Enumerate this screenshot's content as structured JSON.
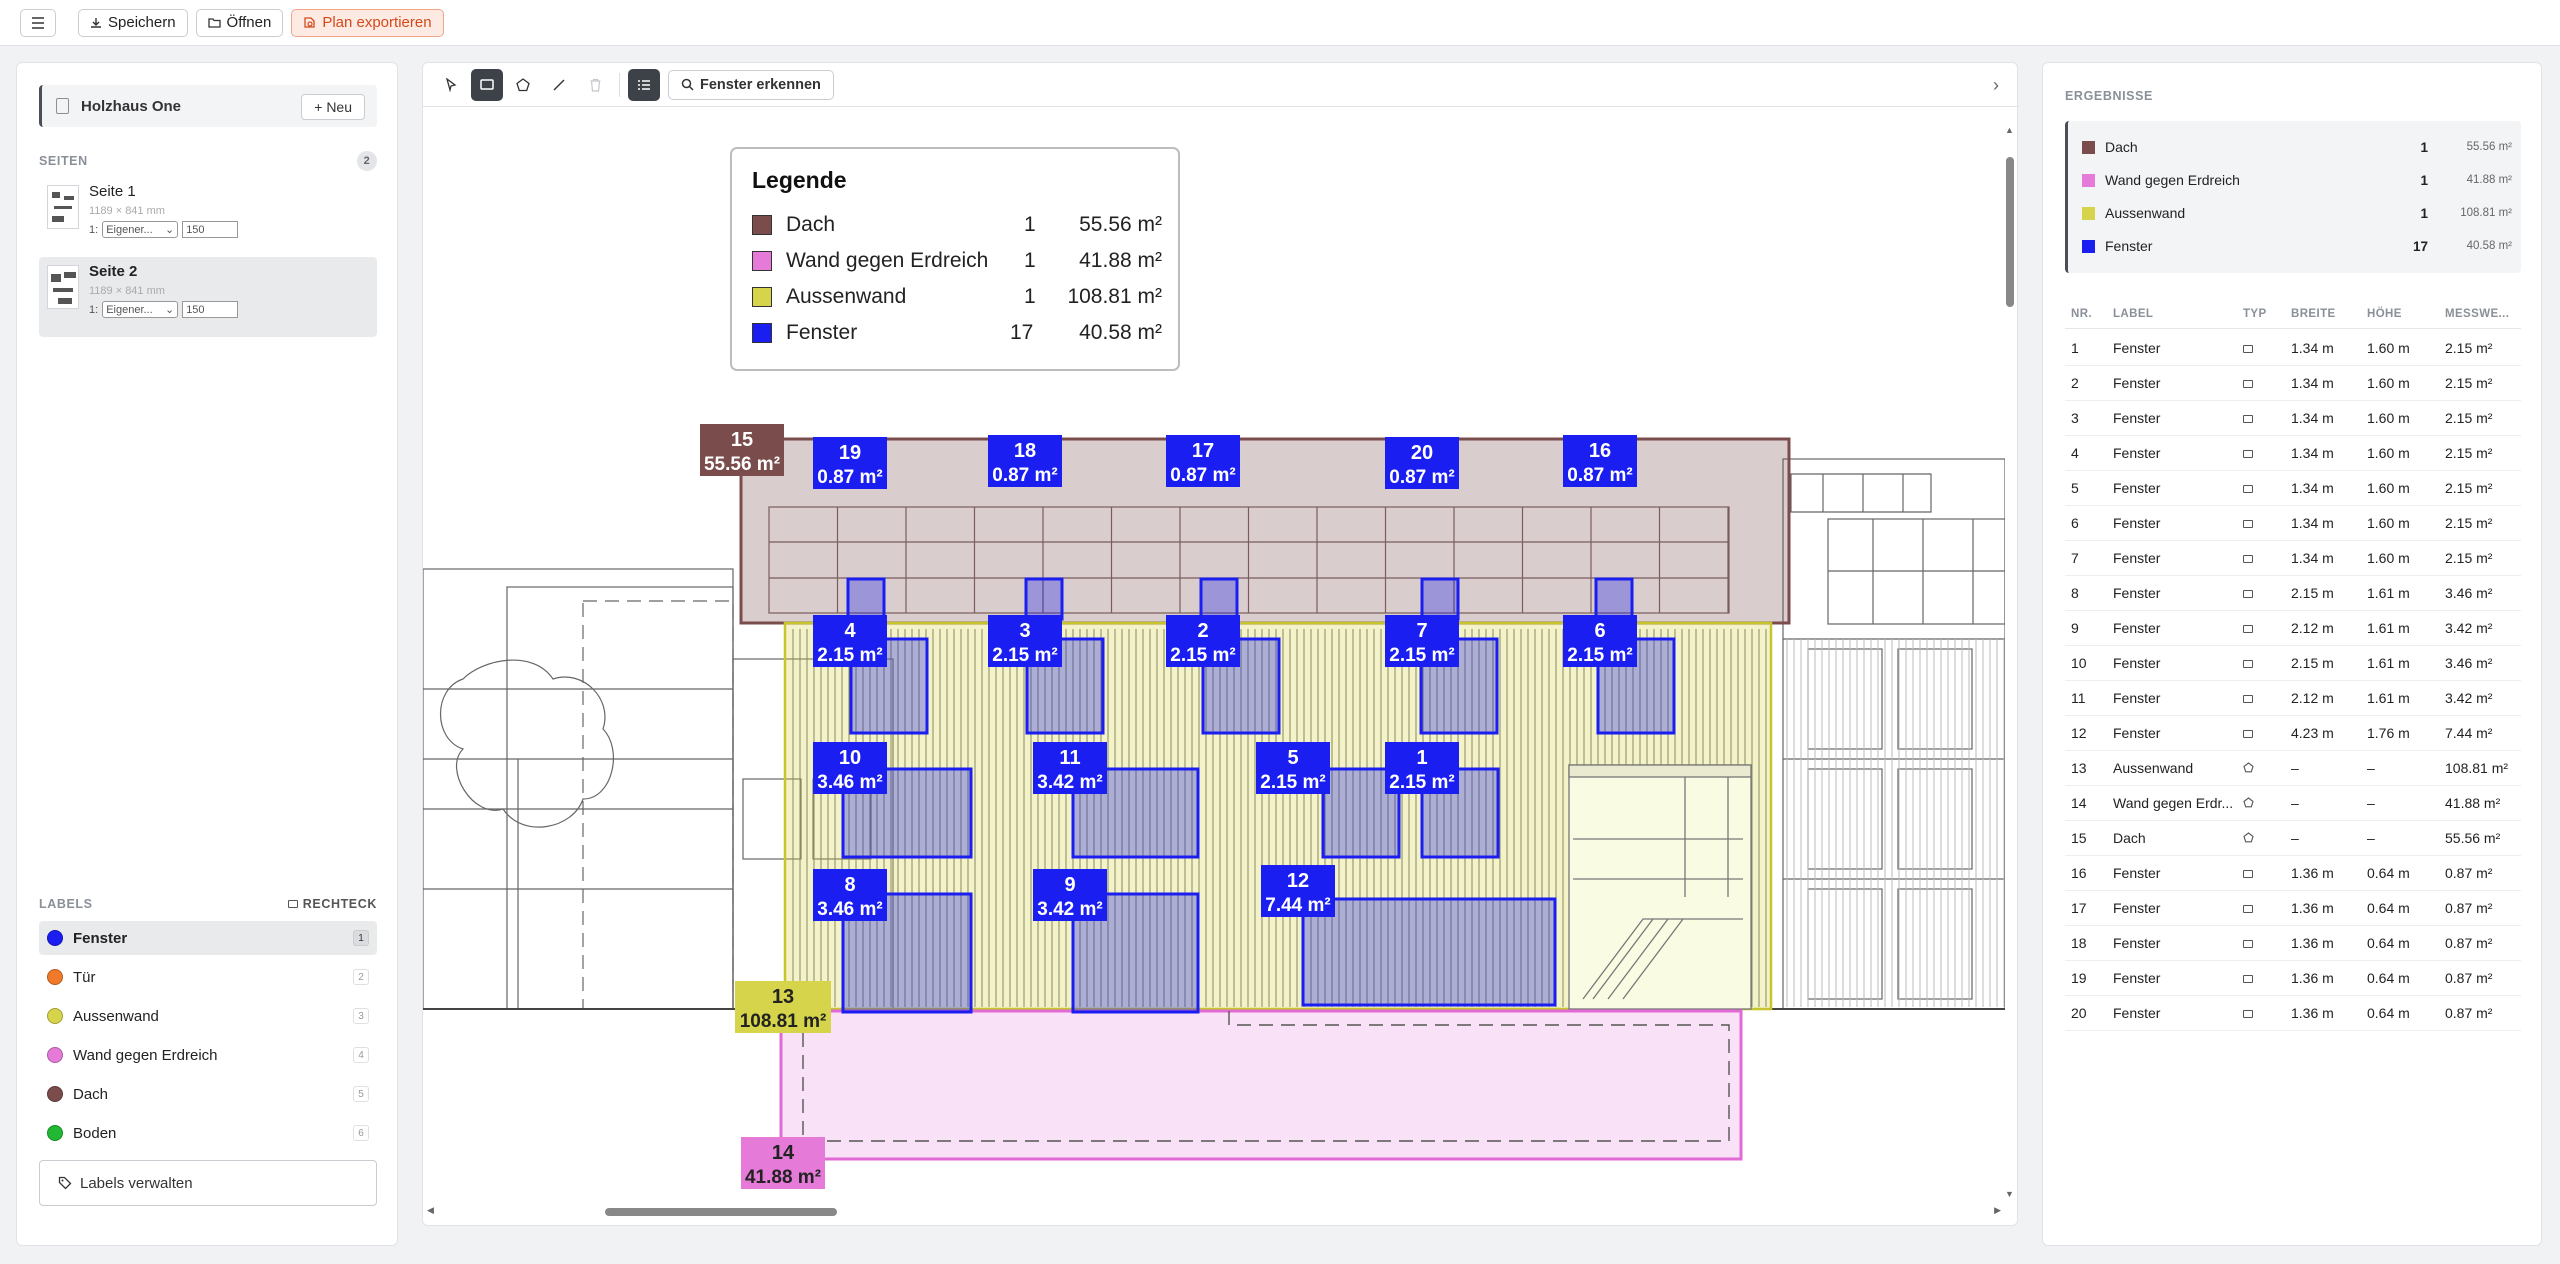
{
  "toolbar": {
    "save": "Speichern",
    "open": "Öffnen",
    "export": "Plan exportieren"
  },
  "project": {
    "name": "Holzhaus One",
    "new_button": "+ Neu"
  },
  "pages": {
    "header": "SEITEN",
    "count": "2",
    "items": [
      {
        "title": "Seite 1",
        "dims": "1189 × 841 mm",
        "prefix": "1:",
        "scale_option": "Eigener...",
        "scale_value": "150"
      },
      {
        "title": "Seite 2",
        "dims": "1189 × 841 mm",
        "prefix": "1:",
        "scale_option": "Eigener...",
        "scale_value": "150"
      }
    ]
  },
  "labels": {
    "header": "LABELS",
    "mode": "RECHTECK",
    "items": [
      {
        "name": "Fenster",
        "num": "1",
        "color": "#1a1ef0"
      },
      {
        "name": "Tür",
        "num": "2",
        "color": "#f07a2a"
      },
      {
        "name": "Aussenwand",
        "num": "3",
        "color": "#d6d44a"
      },
      {
        "name": "Wand gegen Erdreich",
        "num": "4",
        "color": "#e57ad9"
      },
      {
        "name": "Dach",
        "num": "5",
        "color": "#7a4c4c"
      },
      {
        "name": "Boden",
        "num": "6",
        "color": "#22b833"
      }
    ],
    "manage_button": "Labels verwalten"
  },
  "canvas_toolbar": {
    "detect_button": "Fenster erkennen"
  },
  "legend": {
    "title": "Legende",
    "rows": [
      {
        "name": "Dach",
        "count": "1",
        "area": "55.56 m²",
        "color": "#7a4c4c"
      },
      {
        "name": "Wand gegen Erdreich",
        "count": "1",
        "area": "41.88 m²",
        "color": "#e57ad9"
      },
      {
        "name": "Aussenwand",
        "count": "1",
        "area": "108.81 m²",
        "color": "#d6d44a"
      },
      {
        "name": "Fenster",
        "count": "17",
        "area": "40.58 m²",
        "color": "#1a1ef0"
      }
    ]
  },
  "annotations": [
    {
      "num": "15",
      "area": "55.56 m²"
    },
    {
      "num": "19",
      "area": "0.87 m²"
    },
    {
      "num": "18",
      "area": "0.87 m²"
    },
    {
      "num": "17",
      "area": "0.87 m²"
    },
    {
      "num": "20",
      "area": "0.87 m²"
    },
    {
      "num": "16",
      "area": "0.87 m²"
    },
    {
      "num": "4",
      "area": "2.15 m²"
    },
    {
      "num": "3",
      "area": "2.15 m²"
    },
    {
      "num": "2",
      "area": "2.15 m²"
    },
    {
      "num": "7",
      "area": "2.15 m²"
    },
    {
      "num": "6",
      "area": "2.15 m²"
    },
    {
      "num": "10",
      "area": "3.46 m²"
    },
    {
      "num": "11",
      "area": "3.42 m²"
    },
    {
      "num": "5",
      "area": "2.15 m²"
    },
    {
      "num": "1",
      "area": "2.15 m²"
    },
    {
      "num": "8",
      "area": "3.46 m²"
    },
    {
      "num": "9",
      "area": "3.42 m²"
    },
    {
      "num": "12",
      "area": "7.44 m²"
    },
    {
      "num": "13",
      "area": "108.81 m²"
    },
    {
      "num": "14",
      "area": "41.88 m²"
    }
  ],
  "results": {
    "header": "ERGEBNISSE",
    "summary": [
      {
        "name": "Dach",
        "count": "1",
        "area": "55.56 m²",
        "color": "#7a4c4c"
      },
      {
        "name": "Wand gegen Erdreich",
        "count": "1",
        "area": "41.88 m²",
        "color": "#e57ad9"
      },
      {
        "name": "Aussenwand",
        "count": "1",
        "area": "108.81 m²",
        "color": "#d6d44a"
      },
      {
        "name": "Fenster",
        "count": "17",
        "area": "40.58 m²",
        "color": "#1a1ef0"
      }
    ],
    "columns": [
      "NR.",
      "LABEL",
      "TYP",
      "BREITE",
      "HÖHE",
      "MESSWE..."
    ],
    "rows": [
      {
        "nr": "1",
        "label": "Fenster",
        "typ": "rect",
        "w": "1.34 m",
        "h": "1.60 m",
        "m": "2.15 m²"
      },
      {
        "nr": "2",
        "label": "Fenster",
        "typ": "rect",
        "w": "1.34 m",
        "h": "1.60 m",
        "m": "2.15 m²"
      },
      {
        "nr": "3",
        "label": "Fenster",
        "typ": "rect",
        "w": "1.34 m",
        "h": "1.60 m",
        "m": "2.15 m²"
      },
      {
        "nr": "4",
        "label": "Fenster",
        "typ": "rect",
        "w": "1.34 m",
        "h": "1.60 m",
        "m": "2.15 m²"
      },
      {
        "nr": "5",
        "label": "Fenster",
        "typ": "rect",
        "w": "1.34 m",
        "h": "1.60 m",
        "m": "2.15 m²"
      },
      {
        "nr": "6",
        "label": "Fenster",
        "typ": "rect",
        "w": "1.34 m",
        "h": "1.60 m",
        "m": "2.15 m²"
      },
      {
        "nr": "7",
        "label": "Fenster",
        "typ": "rect",
        "w": "1.34 m",
        "h": "1.60 m",
        "m": "2.15 m²"
      },
      {
        "nr": "8",
        "label": "Fenster",
        "typ": "rect",
        "w": "2.15 m",
        "h": "1.61 m",
        "m": "3.46 m²"
      },
      {
        "nr": "9",
        "label": "Fenster",
        "typ": "rect",
        "w": "2.12 m",
        "h": "1.61 m",
        "m": "3.42 m²"
      },
      {
        "nr": "10",
        "label": "Fenster",
        "typ": "rect",
        "w": "2.15 m",
        "h": "1.61 m",
        "m": "3.46 m²"
      },
      {
        "nr": "11",
        "label": "Fenster",
        "typ": "rect",
        "w": "2.12 m",
        "h": "1.61 m",
        "m": "3.42 m²"
      },
      {
        "nr": "12",
        "label": "Fenster",
        "typ": "rect",
        "w": "4.23 m",
        "h": "1.76 m",
        "m": "7.44 m²"
      },
      {
        "nr": "13",
        "label": "Aussenwand",
        "typ": "poly",
        "w": "–",
        "h": "–",
        "m": "108.81 m²"
      },
      {
        "nr": "14",
        "label": "Wand gegen Erdr...",
        "typ": "poly",
        "w": "–",
        "h": "–",
        "m": "41.88 m²"
      },
      {
        "nr": "15",
        "label": "Dach",
        "typ": "poly",
        "w": "–",
        "h": "–",
        "m": "55.56 m²"
      },
      {
        "nr": "16",
        "label": "Fenster",
        "typ": "rect",
        "w": "1.36 m",
        "h": "0.64 m",
        "m": "0.87 m²"
      },
      {
        "nr": "17",
        "label": "Fenster",
        "typ": "rect",
        "w": "1.36 m",
        "h": "0.64 m",
        "m": "0.87 m²"
      },
      {
        "nr": "18",
        "label": "Fenster",
        "typ": "rect",
        "w": "1.36 m",
        "h": "0.64 m",
        "m": "0.87 m²"
      },
      {
        "nr": "19",
        "label": "Fenster",
        "typ": "rect",
        "w": "1.36 m",
        "h": "0.64 m",
        "m": "0.87 m²"
      },
      {
        "nr": "20",
        "label": "Fenster",
        "typ": "rect",
        "w": "1.36 m",
        "h": "0.64 m",
        "m": "0.87 m²"
      }
    ]
  }
}
